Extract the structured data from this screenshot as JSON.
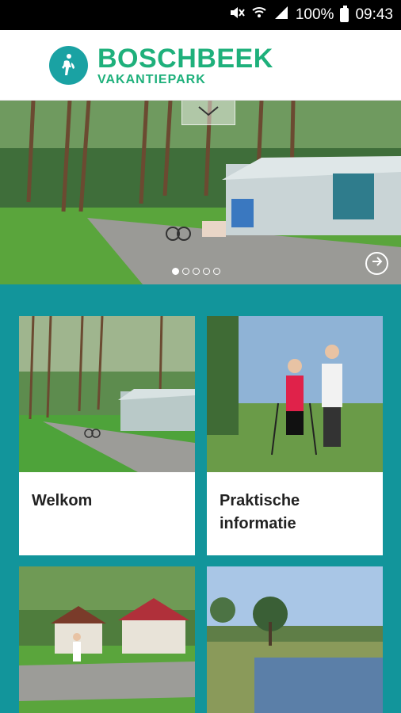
{
  "status_bar": {
    "battery_percent": "100%",
    "time": "09:43",
    "icons": [
      "mute-icon",
      "wifi-calling-icon",
      "signal-icon",
      "battery-icon"
    ]
  },
  "header": {
    "brand_title": "BOSCHBEEK",
    "brand_subtitle": "VAKANTIEPARK"
  },
  "carousel": {
    "slide_count": 5,
    "active_index": 0
  },
  "cards": [
    {
      "label": "Welkom"
    },
    {
      "label": "Praktische informatie"
    },
    {
      "label": ""
    },
    {
      "label": ""
    }
  ],
  "colors": {
    "teal": "#12959b",
    "brand_green": "#1eb07b",
    "logo_teal": "#1aa2a3"
  }
}
